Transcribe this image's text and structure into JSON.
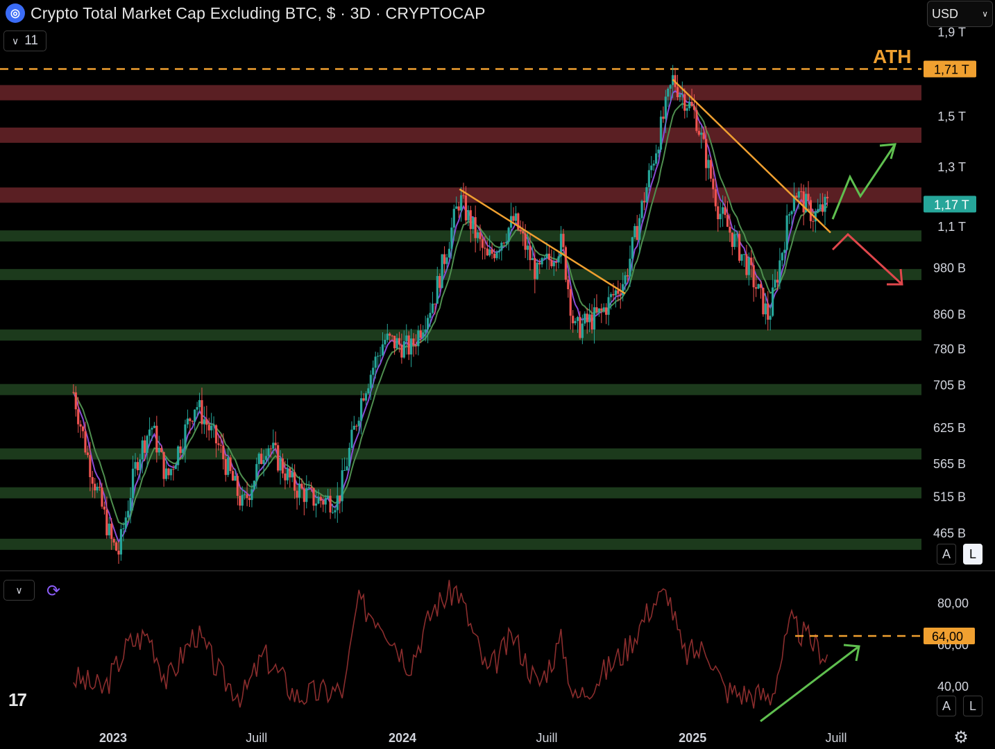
{
  "header": {
    "title": "Crypto Total Market Cap Excluding BTC, $ · 3D · CRYPTOCAP",
    "indicator_count": "11",
    "currency": "USD"
  },
  "annotations": {
    "ath_label": "ATH"
  },
  "scale_buttons": {
    "auto": "A",
    "log": "L"
  },
  "colors": {
    "up": "#26a69a",
    "down": "#ef5350",
    "ema_fast": "#8a4bd6",
    "ema_slow": "#4f8f4f",
    "trendline": "#f0a030",
    "resistance_zone": "#5a1f23",
    "support_zone": "#1c3a1c",
    "rsi_line": "#8b2d2d",
    "price_badge": "#26a69a",
    "ath_badge": "#f0a030"
  },
  "chart_data": [
    {
      "type": "candlestick",
      "title": "Crypto Total Market Cap Excluding BTC, $ · 3D · CRYPTOCAP",
      "scale": "log",
      "y_unit": "USD",
      "y_tick_labels": [
        "1,9 T",
        "1,5 T",
        "1,3 T",
        "1,1 T",
        "980 B",
        "860 B",
        "780 B",
        "705 B",
        "625 B",
        "565 B",
        "515 B",
        "465 B"
      ],
      "y_tick_values": [
        1900000000000.0,
        1500000000000.0,
        1300000000000.0,
        1100000000000.0,
        980000000000.0,
        860000000000.0,
        780000000000.0,
        705000000000.0,
        625000000000.0,
        565000000000.0,
        515000000000.0,
        465000000000.0
      ],
      "x_tick_labels": [
        "2023",
        "Juill",
        "2024",
        "Juill",
        "2025",
        "Juill"
      ],
      "x_tick_dates": [
        "2023-01-01",
        "2023-07-01",
        "2024-01-01",
        "2024-07-01",
        "2025-01-01",
        "2025-07-01"
      ],
      "current_price_label": "1,17 T",
      "current_price": 1170000000000.0,
      "ath_price_label": "1,71 T",
      "ath_price": 1710000000000.0,
      "resistance_zones": [
        1600000000000.0,
        1420000000000.0,
        1200000000000.0
      ],
      "support_zones": [
        1070000000000.0,
        960000000000.0,
        810000000000.0,
        695000000000.0,
        580000000000.0,
        520000000000.0,
        450000000000.0
      ],
      "price_path": [
        [
          "2022-11-12",
          690000000000.0
        ],
        [
          "2022-12-01",
          570000000000.0
        ],
        [
          "2022-12-31",
          450000000000.0
        ],
        [
          "2023-01-08",
          440000000000.0
        ],
        [
          "2023-01-31",
          570000000000.0
        ],
        [
          "2023-02-18",
          630000000000.0
        ],
        [
          "2023-03-10",
          540000000000.0
        ],
        [
          "2023-04-15",
          670000000000.0
        ],
        [
          "2023-05-15",
          590000000000.0
        ],
        [
          "2023-06-14",
          500000000000.0
        ],
        [
          "2023-07-14",
          600000000000.0
        ],
        [
          "2023-08-17",
          530000000000.0
        ],
        [
          "2023-09-12",
          510000000000.0
        ],
        [
          "2023-10-12",
          510000000000.0
        ],
        [
          "2023-11-12",
          690000000000.0
        ],
        [
          "2023-12-09",
          800000000000.0
        ],
        [
          "2024-01-12",
          780000000000.0
        ],
        [
          "2024-02-10",
          900000000000.0
        ],
        [
          "2024-03-13",
          1190000000000.0
        ],
        [
          "2024-04-17",
          1000000000000.0
        ],
        [
          "2024-05-21",
          1120000000000.0
        ],
        [
          "2024-06-19",
          960000000000.0
        ],
        [
          "2024-07-20",
          1050000000000.0
        ],
        [
          "2024-08-05",
          820000000000.0
        ],
        [
          "2024-09-07",
          860000000000.0
        ],
        [
          "2024-10-08",
          950000000000.0
        ],
        [
          "2024-11-10",
          1300000000000.0
        ],
        [
          "2024-12-07",
          1660000000000.0
        ],
        [
          "2025-01-05",
          1500000000000.0
        ],
        [
          "2025-02-03",
          1150000000000.0
        ],
        [
          "2025-03-10",
          990000000000.0
        ],
        [
          "2025-04-07",
          850000000000.0
        ],
        [
          "2025-05-09",
          1220000000000.0
        ],
        [
          "2025-06-03",
          1130000000000.0
        ],
        [
          "2025-06-21",
          1170000000000.0
        ]
      ],
      "trendlines": [
        {
          "from": [
            "2024-03-13",
            1220000000000.0
          ],
          "to": [
            "2024-10-08",
            910000000000.0
          ]
        },
        {
          "from": [
            "2024-12-07",
            1660000000000.0
          ],
          "to": [
            "2025-06-24",
            1080000000000.0
          ]
        }
      ],
      "scenarios": [
        "bullish breakout",
        "bearish rejection"
      ]
    },
    {
      "type": "line",
      "title": "",
      "y_tick_labels": [
        "80,00",
        "60,00",
        "40,00"
      ],
      "y_tick_values": [
        80,
        60,
        40
      ],
      "marked_level_label": "64,00",
      "marked_level": 64,
      "values_path": [
        [
          "2022-11-12",
          44
        ],
        [
          "2022-12-20",
          38
        ],
        [
          "2023-01-20",
          60
        ],
        [
          "2023-02-15",
          65
        ],
        [
          "2023-03-10",
          42
        ],
        [
          "2023-04-15",
          66
        ],
        [
          "2023-05-20",
          43
        ],
        [
          "2023-06-14",
          35
        ],
        [
          "2023-07-10",
          55
        ],
        [
          "2023-08-20",
          35
        ],
        [
          "2023-09-20",
          37
        ],
        [
          "2023-10-20",
          38
        ],
        [
          "2023-11-05",
          80
        ],
        [
          "2023-12-05",
          72
        ],
        [
          "2024-01-10",
          50
        ],
        [
          "2024-02-10",
          78
        ],
        [
          "2024-03-10",
          87
        ],
        [
          "2024-04-17",
          46
        ],
        [
          "2024-05-20",
          64
        ],
        [
          "2024-06-20",
          40
        ],
        [
          "2024-07-20",
          62
        ],
        [
          "2024-08-05",
          33
        ],
        [
          "2024-09-07",
          45
        ],
        [
          "2024-10-10",
          58
        ],
        [
          "2024-11-12",
          80
        ],
        [
          "2024-12-01",
          85
        ],
        [
          "2024-12-20",
          55
        ],
        [
          "2025-01-20",
          58
        ],
        [
          "2025-02-10",
          38
        ],
        [
          "2025-03-10",
          36
        ],
        [
          "2025-04-10",
          35
        ],
        [
          "2025-05-05",
          70
        ],
        [
          "2025-06-21",
          54
        ]
      ]
    }
  ]
}
